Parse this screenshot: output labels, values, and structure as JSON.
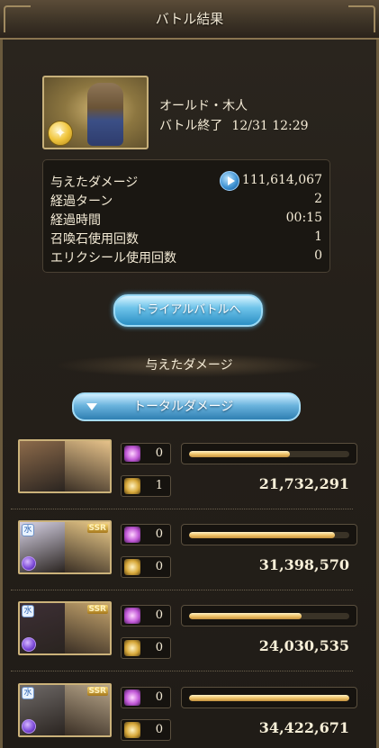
{
  "header": {
    "title": "バトル結果"
  },
  "enemy": {
    "name": "オールド・木人",
    "status": "バトル終了",
    "datetime": "12/31 12:29"
  },
  "stats": [
    {
      "label": "与えたダメージ",
      "value": "111,614,067",
      "icon": "play-icon"
    },
    {
      "label": "経過ターン",
      "value": "2"
    },
    {
      "label": "経過時間",
      "value": "00:15"
    },
    {
      "label": "召喚石使用回数",
      "value": "1"
    },
    {
      "label": "エリクシール使用回数",
      "value": "0"
    }
  ],
  "trial_button": {
    "label": "トライアルバトルへ"
  },
  "damage_section": {
    "header": "与えたダメージ",
    "selector_label": "トータルダメージ"
  },
  "characters": [
    {
      "burst_count": "0",
      "chain_count": "1",
      "damage": "21,732,291",
      "bar_fraction": 0.63,
      "ssr": "",
      "element": "",
      "colors": [
        "#8c6a4a",
        "#e6c28a"
      ]
    },
    {
      "burst_count": "0",
      "chain_count": "0",
      "damage": "31,398,570",
      "bar_fraction": 0.91,
      "ssr": "SSR",
      "element": "水",
      "colors": [
        "#d8d3e6",
        "#f0cf8c"
      ]
    },
    {
      "burst_count": "0",
      "chain_count": "0",
      "damage": "24,030,535",
      "bar_fraction": 0.7,
      "ssr": "SSR",
      "element": "水",
      "colors": [
        "#3d2f35",
        "#c7a66e"
      ]
    },
    {
      "burst_count": "0",
      "chain_count": "0",
      "damage": "34,422,671",
      "bar_fraction": 1.0,
      "ssr": "SSR",
      "element": "水",
      "colors": [
        "#6f6a68",
        "#b8a68a"
      ]
    }
  ],
  "icons": {
    "burst": "burst-star-icon",
    "chain": "chain-burst-icon",
    "moon": "dark-moon-icon"
  }
}
